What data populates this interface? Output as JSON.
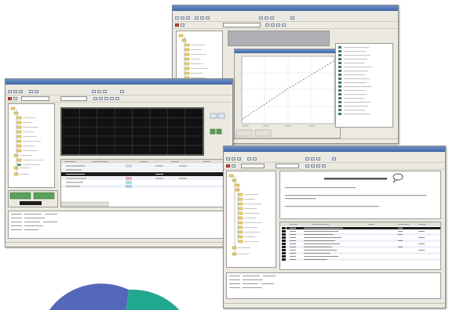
{
  "colors": {
    "titlebar": "#3d65a8",
    "window_chrome": "#ece9e0",
    "scope_background": "#111111",
    "scope_grid": "#3e3e3e",
    "plot_line": "#6b6b6b",
    "pie_blue": "#5567b8",
    "pie_teal": "#23a890",
    "legend_green": "#3c7a55"
  },
  "window_top_right": {
    "title": "",
    "tree": {
      "items": []
    },
    "plot": {
      "type": "line"
    },
    "legend": {
      "entries": []
    }
  },
  "window_left": {
    "title": "",
    "scope": {
      "type": "oscilloscope"
    },
    "table": {
      "rows": []
    }
  },
  "window_bottom_right": {
    "title": "",
    "document": {
      "heading": "",
      "paragraphs": []
    },
    "table": {
      "rows": []
    }
  },
  "decor": {
    "pie_partial": true
  }
}
